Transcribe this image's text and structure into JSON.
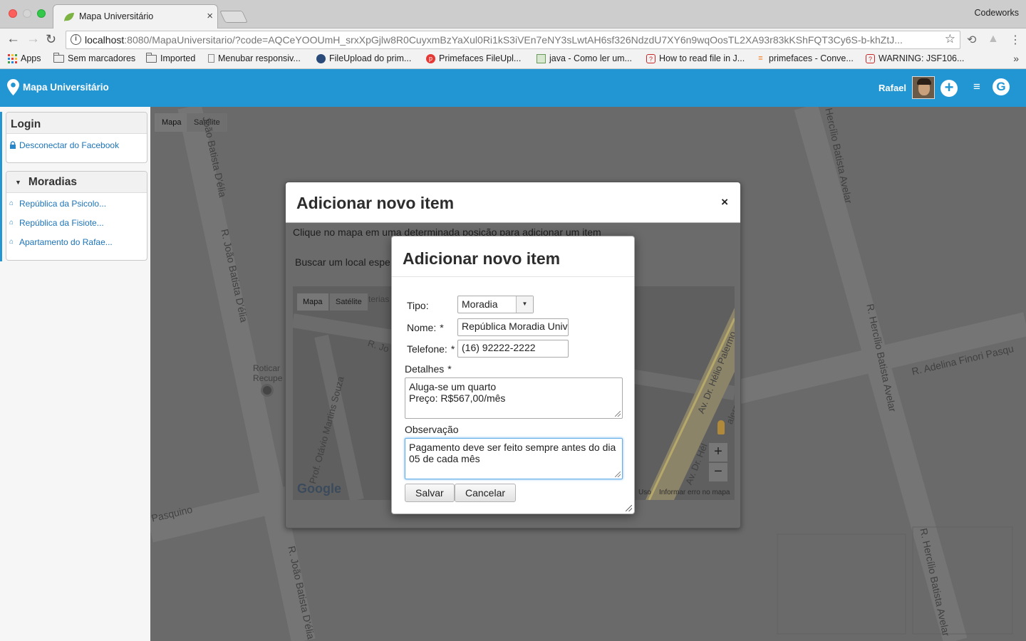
{
  "browser": {
    "tab_title": "Mapa Universitário",
    "profile_name": "Codeworks",
    "url_host": "localhost",
    "url_rest": ":8080/MapaUniversitario/?code=AQCeYOOUmH_srxXpGjlw8R0CuyxmBzYaXul0Ri1kS3iVEn7eNY3sLwtAH6sf326NdzdU7XY6n9wqOosTL2XA93r83kKShFQT3Cy6S-b-khZtJ...",
    "bookmarks": [
      "Apps",
      "Sem marcadores",
      "Imported",
      "Menubar responsiv...",
      "FileUpload do prim...",
      "Primefaces FileUpl...",
      "java - Como ler um...",
      "How to read file in J...",
      "primefaces - Conve...",
      "WARNING: JSF106..."
    ],
    "more_bookmarks": "»"
  },
  "appbar": {
    "title": "Mapa Universitário",
    "user_name": "Rafael"
  },
  "sidebar": {
    "login_title": "Login",
    "login_link": "Desconectar do Facebook",
    "moradias_title": "Moradias",
    "moradias": [
      "República da Psicolo...",
      "República da Fisiote...",
      "Apartamento do Rafae..."
    ]
  },
  "map": {
    "type_map": "Mapa",
    "type_satellite": "Satélite",
    "streets": {
      "joao_batista_1": "João Batista D'élia",
      "joao_batista_2": "R. João Batista D'élia",
      "joao_batista_3": "R. João Batista D'élia",
      "hercilio_1": "Hercílio Batista Avelar",
      "hercilio_2": "R. Hercílio Batista Avelar",
      "hercilio_3": "R. Hercílio Batista Avelar",
      "adelina": "R. Adelina Finori Pasqu",
      "pasquino": "Pasquino"
    },
    "poi": "Roticar Recupe"
  },
  "outer_dialog": {
    "title": "Adicionar novo item",
    "close": "×",
    "hint": "Clique no mapa em uma determinada posição para adicionar um item",
    "search_label": "Buscar um local espe",
    "minimap": {
      "type_map": "Mapa",
      "type_satellite": "Satélite",
      "street_1": "Prof. Otávio Martins Souza",
      "street_2": "Av. Dr. Hélio Palermo",
      "street_3": "Av. Dr. Hél",
      "street_4": "alermo",
      "street_5": "R. Jo",
      "poi_text": "terias",
      "google": "Google",
      "terms": "Uso",
      "report": "Informar erro no mapa",
      "zoom_in": "+",
      "zoom_out": "−"
    }
  },
  "inner_dialog": {
    "title": "Adicionar novo item",
    "tipo_label": "Tipo:",
    "tipo_value": "Moradia",
    "nome_label": "Nome:",
    "nome_value": "República Moradia Univ",
    "telefone_label": "Telefone:",
    "telefone_value": "(16) 92222-2222",
    "detalhes_label": "Detalhes",
    "detalhes_value": "Aluga-se um quarto\nPreço: R$567,00/mês",
    "observacao_label": "Observação",
    "observacao_value": "Pagamento deve ser feito sempre antes do dia 05 de cada mês",
    "required_mark": "*",
    "save_label": "Salvar",
    "cancel_label": "Cancelar"
  },
  "colors": {
    "brand": "#2196d3",
    "link": "#1c74b8",
    "focus": "#66afe9"
  }
}
